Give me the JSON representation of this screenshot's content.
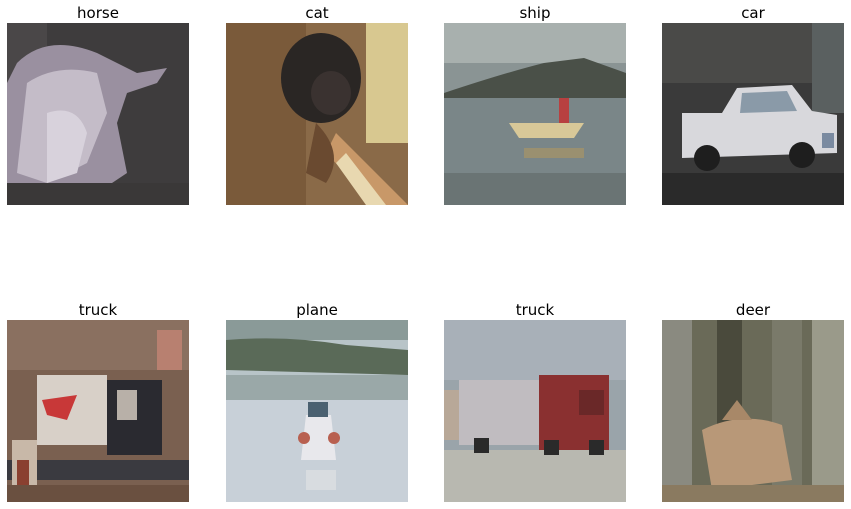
{
  "grid": {
    "images": [
      {
        "label": "horse",
        "subject": "horse head photo"
      },
      {
        "label": "cat",
        "subject": "cat photo"
      },
      {
        "label": "ship",
        "subject": "boat on water photo"
      },
      {
        "label": "car",
        "subject": "white pickup car photo"
      },
      {
        "label": "truck",
        "subject": "truck photo"
      },
      {
        "label": "plane",
        "subject": "plane over water photo"
      },
      {
        "label": "truck",
        "subject": "red semi truck photo"
      },
      {
        "label": "deer",
        "subject": "deer in woods photo"
      }
    ]
  }
}
